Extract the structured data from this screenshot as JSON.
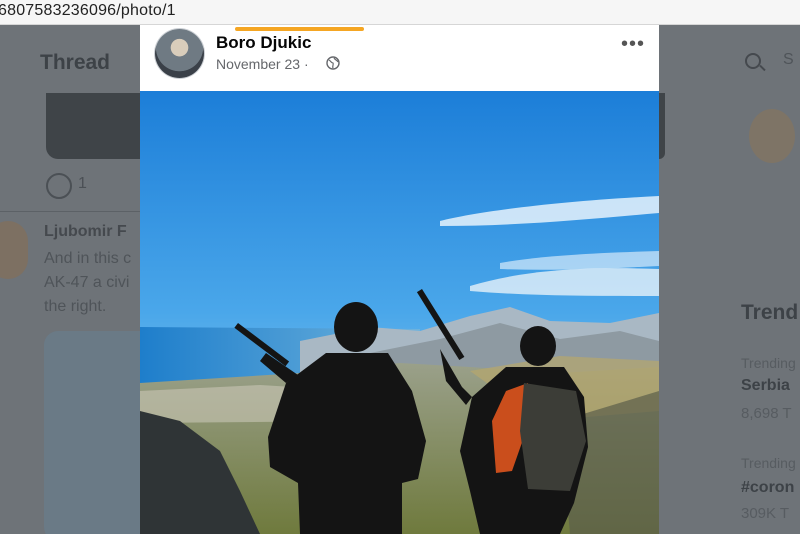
{
  "browser": {
    "url_text": "6807583236096/photo/1"
  },
  "background_left": {
    "title": "Thread",
    "comment_count": "1",
    "reply_name": "Ljubomir F",
    "reply_text": "And in this c\nAK-47 a civi\nthe right."
  },
  "background_right": {
    "search_text": "S",
    "trends_title": "Trend",
    "trend1_label": "Trending",
    "trend1_name": "Serbia",
    "trend1_count": "8,698 T",
    "trend2_label": "Trending",
    "trend2_name": "#coron",
    "trend2_count": "309K T"
  },
  "post": {
    "author": "Boro Djukic",
    "date": "November 23",
    "separator": "·",
    "more_label": "•••",
    "photo_alt": "Two armed hunters silhouetted on a mountain ridge overlooking a coastal town and the sea"
  },
  "colors": {
    "accent_bar": "#f5a623",
    "overlay_bg": "#6e7378"
  }
}
